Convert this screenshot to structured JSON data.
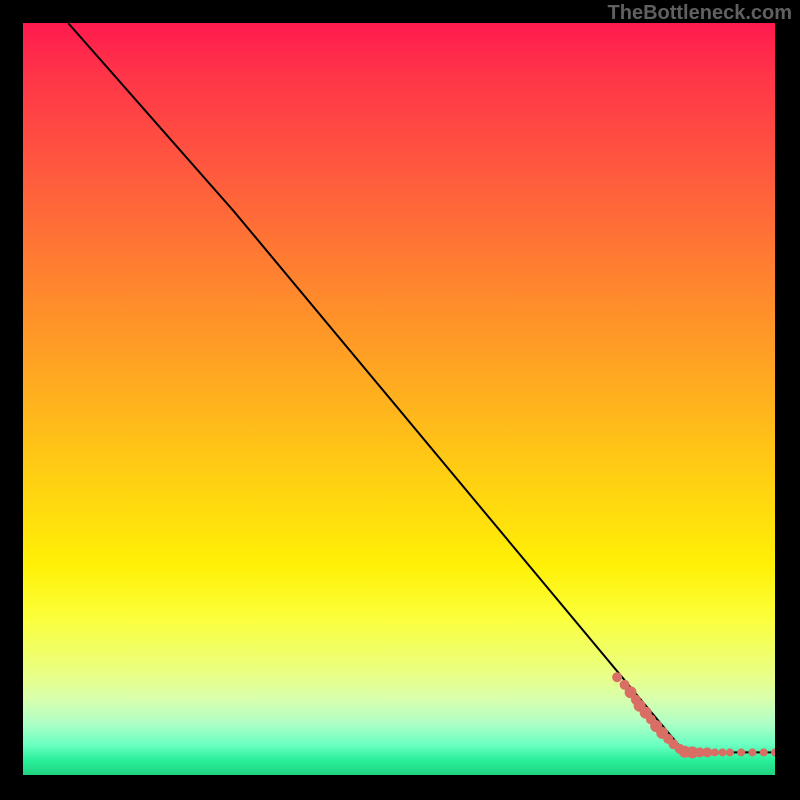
{
  "watermark": "TheBottleneck.com",
  "chart_data": {
    "type": "line",
    "title": "",
    "xlabel": "",
    "ylabel": "",
    "xlim": [
      0,
      100
    ],
    "ylim": [
      0,
      100
    ],
    "line": {
      "points": [
        {
          "x": 6,
          "y": 100
        },
        {
          "x": 28,
          "y": 75
        },
        {
          "x": 88,
          "y": 3
        },
        {
          "x": 100,
          "y": 3
        }
      ]
    },
    "scatter": {
      "name": "data-points",
      "color": "#d86e64",
      "radius_range": [
        3,
        7
      ],
      "points": [
        {
          "x": 79,
          "y": 13,
          "r": 5
        },
        {
          "x": 80,
          "y": 12,
          "r": 5
        },
        {
          "x": 80.8,
          "y": 11,
          "r": 6
        },
        {
          "x": 81.5,
          "y": 10,
          "r": 5
        },
        {
          "x": 82,
          "y": 9.2,
          "r": 6
        },
        {
          "x": 82.8,
          "y": 8.3,
          "r": 6
        },
        {
          "x": 83.5,
          "y": 7.4,
          "r": 5
        },
        {
          "x": 84.2,
          "y": 6.5,
          "r": 6
        },
        {
          "x": 85,
          "y": 5.6,
          "r": 6
        },
        {
          "x": 85.8,
          "y": 4.8,
          "r": 5
        },
        {
          "x": 86.5,
          "y": 4.1,
          "r": 5
        },
        {
          "x": 87.3,
          "y": 3.5,
          "r": 5
        },
        {
          "x": 88,
          "y": 3.1,
          "r": 6
        },
        {
          "x": 89,
          "y": 3,
          "r": 6
        },
        {
          "x": 90,
          "y": 3,
          "r": 5
        },
        {
          "x": 91,
          "y": 3,
          "r": 5
        },
        {
          "x": 92,
          "y": 3,
          "r": 4
        },
        {
          "x": 93,
          "y": 3,
          "r": 4
        },
        {
          "x": 94,
          "y": 3,
          "r": 4
        },
        {
          "x": 95.5,
          "y": 3,
          "r": 4
        },
        {
          "x": 97,
          "y": 3,
          "r": 4
        },
        {
          "x": 98.5,
          "y": 3,
          "r": 4
        },
        {
          "x": 100,
          "y": 3,
          "r": 4
        }
      ]
    }
  }
}
